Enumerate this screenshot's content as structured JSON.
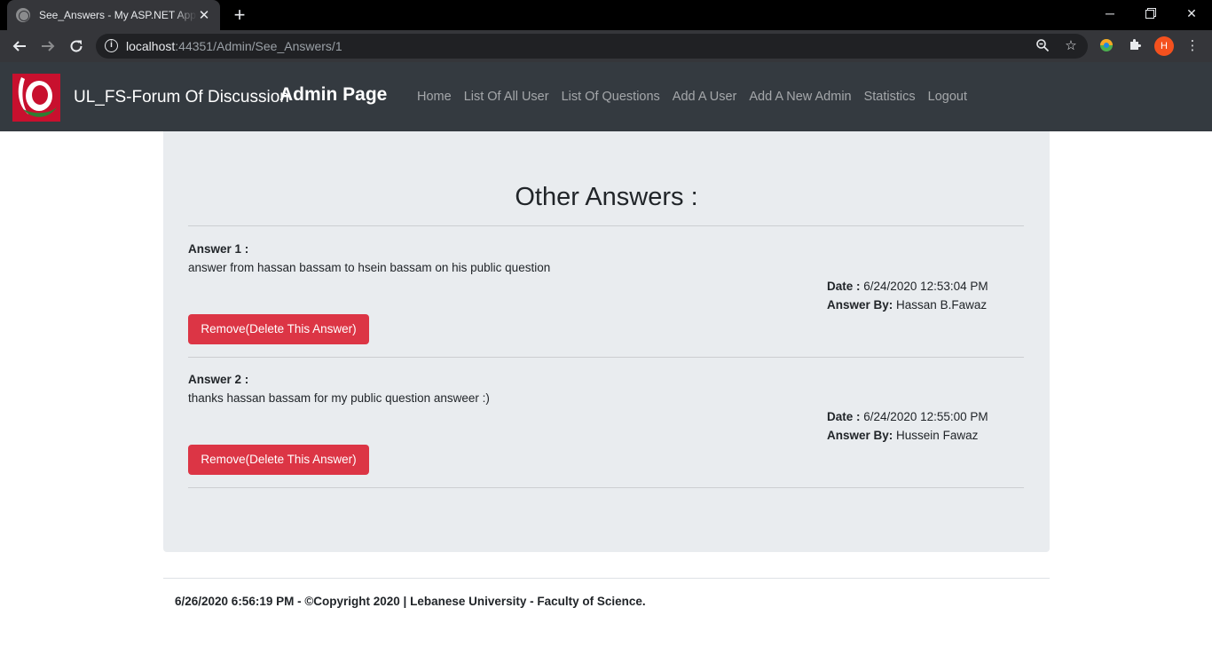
{
  "browser": {
    "tab_title": "See_Answers - My ASP.NET Application",
    "url_host": "localhost",
    "url_rest": ":44351/Admin/See_Answers/1",
    "profile_initial": "H"
  },
  "navbar": {
    "brand": "UL_FS-Forum Of Discussion",
    "admin_title": "Admin Page",
    "links": [
      "Home",
      "List Of All User",
      "List Of Questions",
      "Add A User",
      "Add A New Admin",
      "Statistics",
      "Logout"
    ]
  },
  "main": {
    "heading": "Other Answers :",
    "answers": [
      {
        "label": "Answer 1 :",
        "text": "answer from hassan bassam to hsein bassam on his public question",
        "date_label": "Date :",
        "date": "6/24/2020 12:53:04 PM",
        "by_label": "Answer By:",
        "by": "Hassan B.Fawaz",
        "button": "Remove(Delete This Answer)"
      },
      {
        "label": "Answer 2 :",
        "text": "thanks hassan bassam for my public question answeer :)",
        "date_label": "Date :",
        "date": "6/24/2020 12:55:00 PM",
        "by_label": "Answer By:",
        "by": "Hussein Fawaz",
        "button": "Remove(Delete This Answer)"
      }
    ]
  },
  "footer": {
    "text": "6/26/2020 6:56:19 PM - ©Copyright 2020 | Lebanese University - Faculty of Science."
  },
  "colors": {
    "navbar_bg": "#343a40",
    "panel_bg": "#e9ecef",
    "danger": "#dc3545"
  }
}
